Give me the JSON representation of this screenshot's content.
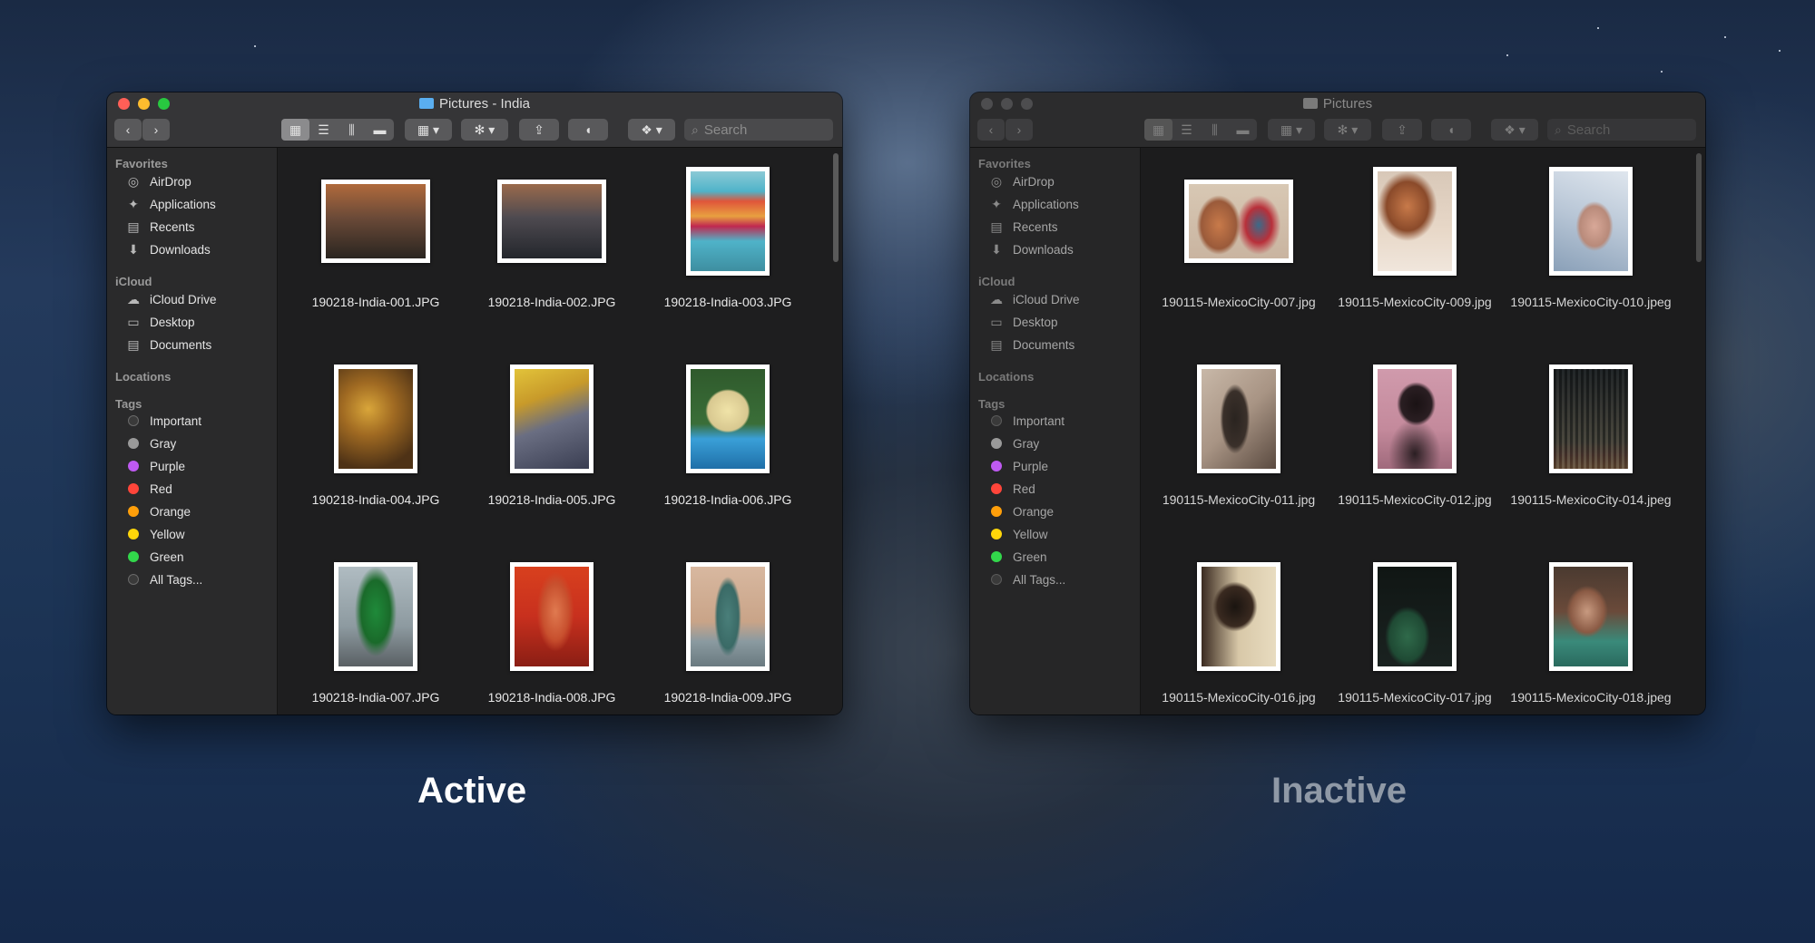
{
  "labels": {
    "active": "Active",
    "inactive": "Inactive"
  },
  "colors": {
    "close": "#ff5f57",
    "minimize": "#febc2e",
    "zoom": "#28c840",
    "inactive_light": "#4d4d4f"
  },
  "toolbar": {
    "search_placeholder": "Search",
    "view_icons": [
      "icon-view-icon",
      "list-view-icon",
      "column-view-icon",
      "gallery-view-icon"
    ],
    "group_icon": "group-icon",
    "action_icon": "gear-icon",
    "share_icon": "share-icon",
    "tag_icon": "tag-icon",
    "dropbox_icon": "dropbox-icon"
  },
  "sidebar": {
    "favorites_header": "Favorites",
    "favorites": [
      {
        "label": "AirDrop",
        "icon": "airdrop-icon"
      },
      {
        "label": "Applications",
        "icon": "applications-icon"
      },
      {
        "label": "Recents",
        "icon": "recents-icon"
      },
      {
        "label": "Downloads",
        "icon": "downloads-icon"
      }
    ],
    "icloud_header": "iCloud",
    "icloud": [
      {
        "label": "iCloud Drive",
        "icon": "cloud-icon"
      },
      {
        "label": "Desktop",
        "icon": "desktop-icon"
      },
      {
        "label": "Documents",
        "icon": "documents-icon"
      }
    ],
    "locations_header": "Locations",
    "tags_header": "Tags",
    "tags": [
      {
        "label": "Important",
        "color": "#3a3a3a"
      },
      {
        "label": "Gray",
        "color": "#9a9a9a"
      },
      {
        "label": "Purple",
        "color": "#bf5af2"
      },
      {
        "label": "Red",
        "color": "#ff453a"
      },
      {
        "label": "Orange",
        "color": "#ff9f0a"
      },
      {
        "label": "Yellow",
        "color": "#ffd60a"
      },
      {
        "label": "Green",
        "color": "#32d74b"
      },
      {
        "label": "All Tags...",
        "color": "#3a3a3a"
      }
    ]
  },
  "windows": [
    {
      "title": "Pictures - India",
      "files": [
        {
          "name": "190218-India-001.JPG",
          "orientation": "landscape",
          "colors": [
            "#3a3128",
            "#b06a3c"
          ]
        },
        {
          "name": "190218-India-002.JPG",
          "orientation": "landscape",
          "colors": [
            "#2e3138",
            "#9a6a4c"
          ]
        },
        {
          "name": "190218-India-003.JPG",
          "orientation": "portrait",
          "colors": [
            "#4fb3c9",
            "#e0553a"
          ]
        },
        {
          "name": "190218-India-004.JPG",
          "orientation": "portrait",
          "colors": [
            "#4e3216",
            "#d9a63a"
          ]
        },
        {
          "name": "190218-India-005.JPG",
          "orientation": "portrait",
          "colors": [
            "#3a3e52",
            "#e2c33a"
          ]
        },
        {
          "name": "190218-India-006.JPG",
          "orientation": "portrait",
          "colors": [
            "#2f5a2c",
            "#f0e3a8"
          ]
        },
        {
          "name": "190218-India-007.JPG",
          "orientation": "portrait",
          "colors": [
            "#8d9aa0",
            "#1f8a3a"
          ]
        },
        {
          "name": "190218-India-008.JPG",
          "orientation": "portrait",
          "colors": [
            "#c8301e",
            "#e07a50"
          ]
        },
        {
          "name": "190218-India-009.JPG",
          "orientation": "portrait",
          "colors": [
            "#c9a488",
            "#4a7f7a"
          ]
        }
      ]
    },
    {
      "title": "Pictures",
      "files": [
        {
          "name": "190115-MexicoCity-007.jpg",
          "orientation": "landscape",
          "colors": [
            "#c9b4a0",
            "#3a6b8a"
          ]
        },
        {
          "name": "190115-MexicoCity-009.jpg",
          "orientation": "portrait",
          "colors": [
            "#c87a4a",
            "#e8d8c8"
          ]
        },
        {
          "name": "190115-MexicoCity-010.jpeg",
          "orientation": "portrait",
          "colors": [
            "#b8c6d6",
            "#d8a898"
          ]
        },
        {
          "name": "190115-MexicoCity-011.jpg",
          "orientation": "portrait",
          "colors": [
            "#a89484",
            "#2a2420"
          ]
        },
        {
          "name": "190115-MexicoCity-012.jpg",
          "orientation": "portrait",
          "colors": [
            "#c48a9c",
            "#2a1e22"
          ]
        },
        {
          "name": "190115-MexicoCity-014.jpeg",
          "orientation": "portrait",
          "colors": [
            "#3a3e40",
            "#9a8a70"
          ]
        },
        {
          "name": "190115-MexicoCity-016.jpg",
          "orientation": "portrait",
          "colors": [
            "#d8c8a8",
            "#3a2a20"
          ]
        },
        {
          "name": "190115-MexicoCity-017.jpg",
          "orientation": "portrait",
          "colors": [
            "#1a2220",
            "#2f6a4a"
          ]
        },
        {
          "name": "190115-MexicoCity-018.jpeg",
          "orientation": "portrait",
          "colors": [
            "#6a4a3a",
            "#3a8a7a"
          ]
        }
      ]
    }
  ]
}
